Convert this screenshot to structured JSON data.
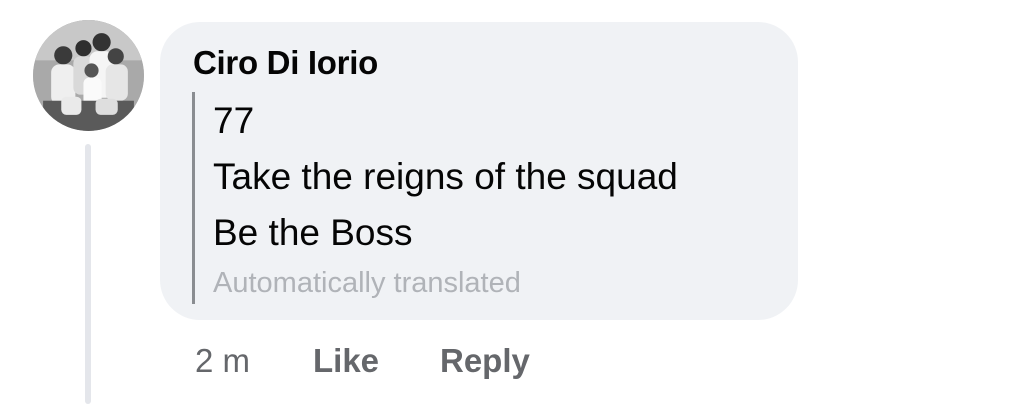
{
  "comment": {
    "author": "Ciro Di Iorio",
    "lines": [
      "77",
      "Take the reigns of the squad",
      "Be the Boss"
    ],
    "translation_note": "Automatically translated",
    "timestamp": "2 m",
    "like_label": "Like",
    "reply_label": "Reply"
  },
  "avatar": {
    "icon": "family-photo-avatar"
  },
  "colors": {
    "bubble": "#f0f2f5",
    "text": "#050505",
    "meta": "#65676b",
    "muted": "#b0b3b8",
    "thread_line": "#e4e6eb"
  }
}
